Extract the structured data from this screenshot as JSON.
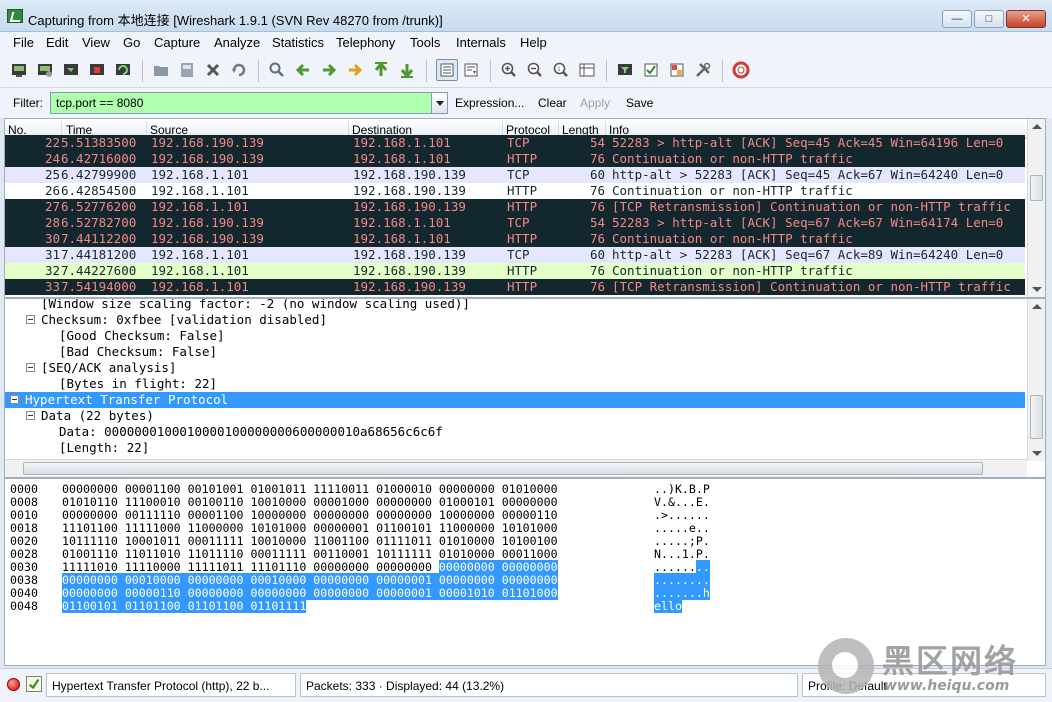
{
  "window": {
    "title": "Capturing from 本地连接    [Wireshark 1.9.1  (SVN Rev 48270 from /trunk)]",
    "min": "—",
    "max": "□",
    "close": "✕"
  },
  "menu": [
    "File",
    "Edit",
    "View",
    "Go",
    "Capture",
    "Analyze",
    "Statistics",
    "Telephony",
    "Tools",
    "Internals",
    "Help"
  ],
  "filter": {
    "label": "Filter:",
    "value": "tcp.port == 8080",
    "expression": "Expression...",
    "clear": "Clear",
    "apply": "Apply",
    "save": "Save"
  },
  "packet_list": {
    "columns": [
      "No.",
      "Time",
      "Source",
      "Destination",
      "Protocol",
      "Length",
      "Info"
    ],
    "rows": [
      {
        "no": "22",
        "time": "5.51383500",
        "src": "192.168.190.139",
        "dst": "192.168.1.101",
        "proto": "TCP",
        "len": "54",
        "info": "52283 > http-alt [ACK] Seq=45 Ack=45 Win=64196 Len=0"
      },
      {
        "no": "24",
        "time": "6.42716000",
        "src": "192.168.190.139",
        "dst": "192.168.1.101",
        "proto": "HTTP",
        "len": "76",
        "info": "Continuation or non-HTTP traffic"
      },
      {
        "no": "25",
        "time": "6.42799900",
        "src": "192.168.1.101",
        "dst": "192.168.190.139",
        "proto": "TCP",
        "len": "60",
        "info": "http-alt > 52283 [ACK] Seq=45 Ack=67 Win=64240 Len=0"
      },
      {
        "no": "26",
        "time": "6.42854500",
        "src": "192.168.1.101",
        "dst": "192.168.190.139",
        "proto": "HTTP",
        "len": "76",
        "info": "Continuation or non-HTTP traffic"
      },
      {
        "no": "27",
        "time": "6.52776200",
        "src": "192.168.1.101",
        "dst": "192.168.190.139",
        "proto": "HTTP",
        "len": "76",
        "info": "[TCP Retransmission] Continuation or non-HTTP traffic"
      },
      {
        "no": "28",
        "time": "6.52782700",
        "src": "192.168.190.139",
        "dst": "192.168.1.101",
        "proto": "TCP",
        "len": "54",
        "info": "52283 > http-alt [ACK] Seq=67 Ack=67 Win=64174 Len=0"
      },
      {
        "no": "30",
        "time": "7.44112200",
        "src": "192.168.190.139",
        "dst": "192.168.1.101",
        "proto": "HTTP",
        "len": "76",
        "info": "Continuation or non-HTTP traffic"
      },
      {
        "no": "31",
        "time": "7.44181200",
        "src": "192.168.1.101",
        "dst": "192.168.190.139",
        "proto": "TCP",
        "len": "60",
        "info": "http-alt > 52283 [ACK] Seq=67 Ack=89 Win=64240 Len=0"
      },
      {
        "no": "32",
        "time": "7.44227600",
        "src": "192.168.1.101",
        "dst": "192.168.190.139",
        "proto": "HTTP",
        "len": "76",
        "info": "Continuation or non-HTTP traffic"
      },
      {
        "no": "33",
        "time": "7.54194000",
        "src": "192.168.1.101",
        "dst": "192.168.190.139",
        "proto": "HTTP",
        "len": "76",
        "info": "[TCP Retransmission] Continuation or non-HTTP traffic"
      }
    ]
  },
  "details": {
    "rows": [
      {
        "text": "[Window size scaling factor: -2 (no window scaling used)]"
      },
      {
        "text": "Checksum: 0xfbee [validation disabled]"
      },
      {
        "text": "[Good Checksum: False]"
      },
      {
        "text": "[Bad Checksum: False]"
      },
      {
        "text": "[SEQ/ACK analysis]"
      },
      {
        "text": "[Bytes in flight: 22]"
      },
      {
        "text": "Hypertext Transfer Protocol"
      },
      {
        "text": "Data (22 bytes)"
      },
      {
        "text": "Data: 0000000100010000100000000600000010a68656c6c6f"
      },
      {
        "text": "[Length: 22]"
      }
    ]
  },
  "bytes": {
    "rows": [
      {
        "off": "0000",
        "a": "00000000 00001100 00101001 01001011 11110011 01000010 00000000 01010000",
        "b": "",
        "asc": "..)K.B.P",
        "asc_hl": ""
      },
      {
        "off": "0008",
        "a": "01010110 11100010 00100110 10010000 00001000 00000000 01000101 00000000",
        "b": "",
        "asc": "V.&...E.",
        "asc_hl": ""
      },
      {
        "off": "0010",
        "a": "00000000 00111110 00001100 10000000 00000000 00000000 10000000 00000110",
        "b": "",
        "asc": ".>......",
        "asc_hl": ""
      },
      {
        "off": "0018",
        "a": "11101100 11111000 11000000 10101000 00000001 01100101 11000000 10101000",
        "b": "",
        "asc": ".....e..",
        "asc_hl": ""
      },
      {
        "off": "0020",
        "a": "10111110 10001011 00011111 10010000 11001100 01111011 01010000 10100100",
        "b": "",
        "asc": ".....;P.",
        "asc_hl": ""
      },
      {
        "off": "0028",
        "a": "01001110 11011010 11011110 00011111 00110001 10111111 01010000 00011000",
        "b": "",
        "asc": "N...1.P.",
        "asc_hl": ""
      },
      {
        "off": "0030",
        "a": "11111010 11110000 11111011 11101110 00000000 00000000 ",
        "b": "00000000 00000000",
        "asc": "......",
        "asc_hl": ".."
      },
      {
        "off": "0038",
        "a": "",
        "b": "00000000 00010000 00000000 00010000 00000000 00000001 00000000 00000000",
        "asc": "",
        "asc_hl": "........"
      },
      {
        "off": "0040",
        "a": "",
        "b": "00000000 00000110 00000000 00000000 00000000 00000001 00001010 01101000",
        "asc": "",
        "asc_hl": ".......h"
      },
      {
        "off": "0048",
        "a": "",
        "b": "01100101 01101100 01101100 01101111",
        "asc": "",
        "asc_hl": "ello"
      }
    ]
  },
  "status": {
    "protocol": "Hypertext Transfer Protocol (http), 22 b...",
    "packets": "Packets: 333 · Displayed: 44 (13.2%)",
    "profile": "Profile: Default"
  },
  "watermark": {
    "cn": "黑区网络",
    "en": "www.heiqu.com"
  }
}
